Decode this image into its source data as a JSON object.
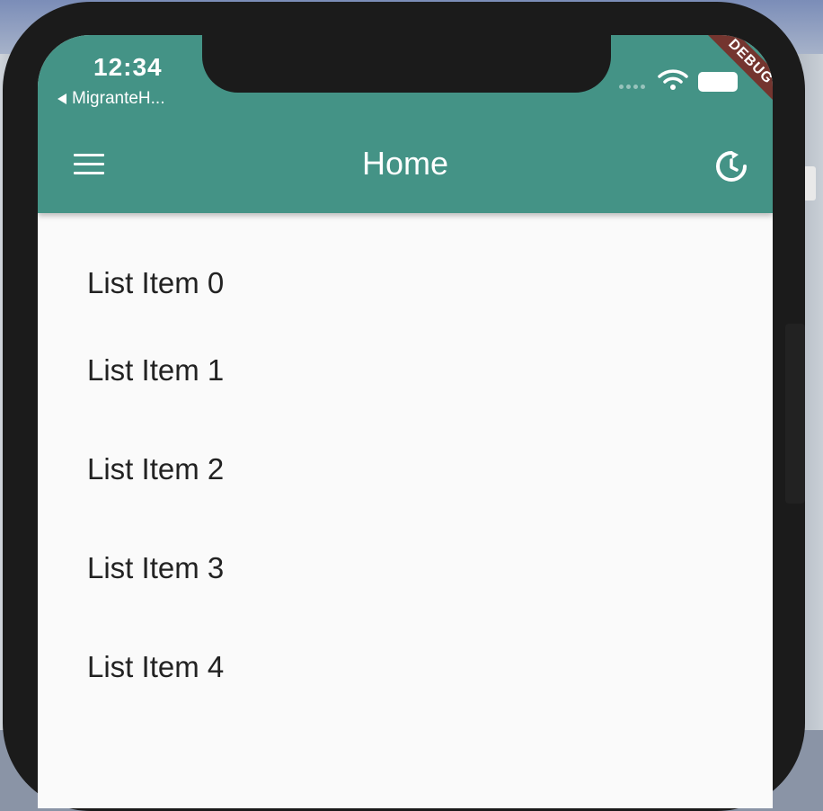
{
  "status_bar": {
    "time": "12:34",
    "back_app": "MigranteH..."
  },
  "debug_banner": "DEBUG",
  "app_bar": {
    "title": "Home",
    "color": "#449386"
  },
  "list": {
    "items": [
      {
        "label": "List Item 0"
      },
      {
        "label": "List Item 1"
      },
      {
        "label": "List Item 2"
      },
      {
        "label": "List Item 3"
      },
      {
        "label": "List Item 4"
      }
    ]
  }
}
